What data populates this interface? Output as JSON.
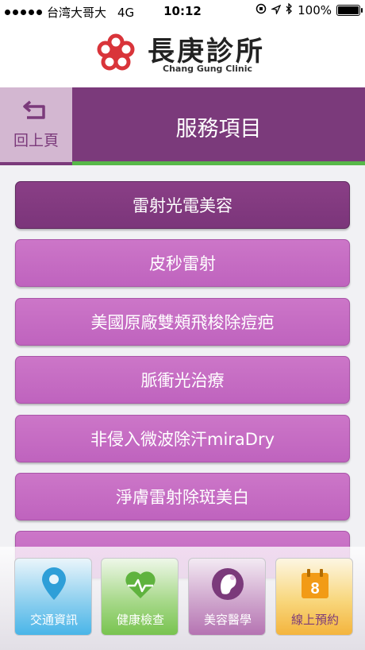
{
  "status_bar": {
    "carrier": "台湾大哥大",
    "network": "4G",
    "time": "10:12",
    "battery": "100%"
  },
  "header": {
    "title_zh": "長庚診所",
    "title_en": "Chang Gung Clinic"
  },
  "nav": {
    "back_label": "回上頁",
    "title": "服務項目"
  },
  "menu": {
    "items": [
      {
        "label": "雷射光電美容"
      },
      {
        "label": "皮秒雷射"
      },
      {
        "label": "美國原廠雙頰飛梭除痘疤"
      },
      {
        "label": "脈衝光治療"
      },
      {
        "label": "非侵入微波除汗miraDry"
      },
      {
        "label": "淨膚雷射除斑美白"
      },
      {
        "label": ""
      }
    ]
  },
  "tabs": [
    {
      "label": "交通資訊",
      "icon": "location-pin-icon"
    },
    {
      "label": "健康檢查",
      "icon": "heart-pulse-icon"
    },
    {
      "label": "美容醫學",
      "icon": "woman-profile-icon"
    },
    {
      "label": "線上預約",
      "icon": "calendar-icon",
      "badge": "8"
    }
  ],
  "colors": {
    "brand_purple": "#7b3a7b",
    "menu_purple": "#c66cc4",
    "accent_green": "#57b849",
    "logo_red": "#d9343a"
  }
}
